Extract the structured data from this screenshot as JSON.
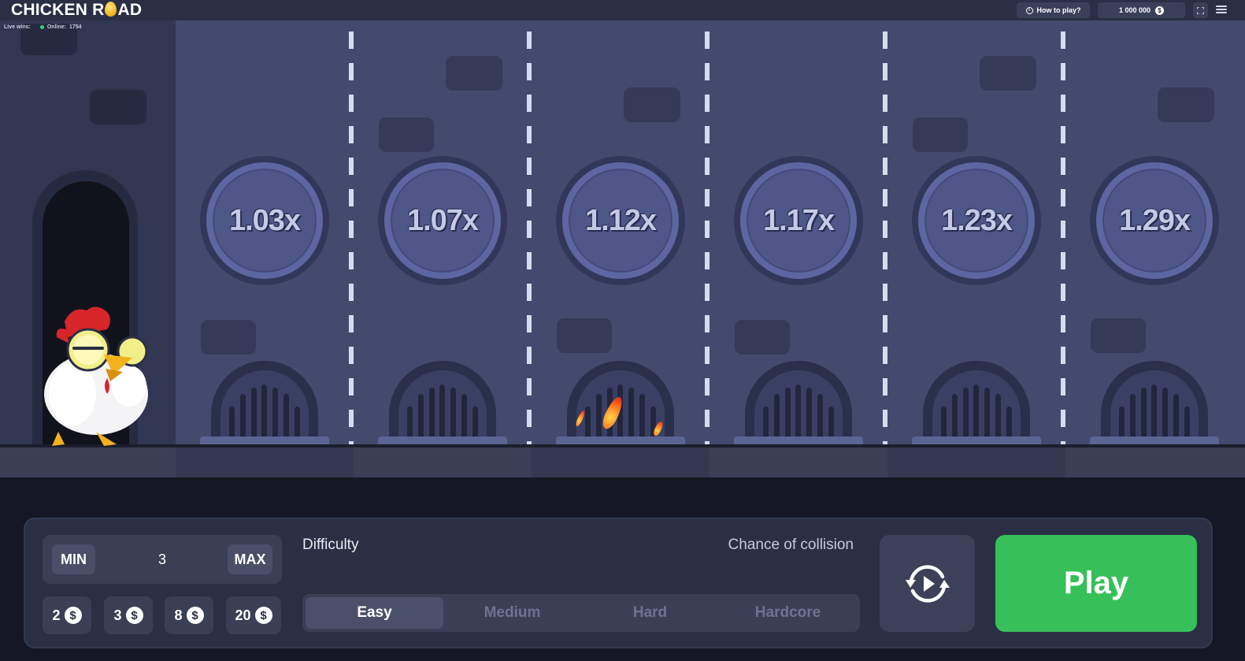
{
  "header": {
    "logo_text_left": "CHICKEN R",
    "logo_text_right": "AD",
    "how_to_play": "How to play?",
    "balance": "1 000 000",
    "currency_symbol": "$"
  },
  "livebar": {
    "live_wins_label": "Live wins:",
    "online_label": "Online:",
    "online_count": "1754"
  },
  "lanes": [
    {
      "multiplier": "1.03x",
      "fire": false
    },
    {
      "multiplier": "1.07x",
      "fire": false
    },
    {
      "multiplier": "1.12x",
      "fire": true
    },
    {
      "multiplier": "1.17x",
      "fire": false
    },
    {
      "multiplier": "1.23x",
      "fire": false
    },
    {
      "multiplier": "1.29x",
      "fire": false
    }
  ],
  "controls": {
    "min_label": "MIN",
    "max_label": "MAX",
    "bet_value": "3",
    "quick_bets": [
      {
        "amount": "2",
        "symbol": "$"
      },
      {
        "amount": "3",
        "symbol": "$"
      },
      {
        "amount": "8",
        "symbol": "$"
      },
      {
        "amount": "20",
        "symbol": "$"
      }
    ],
    "difficulty_label": "Difficulty",
    "chance_label": "Chance of collision",
    "difficulties": [
      "Easy",
      "Medium",
      "Hard",
      "Hardcore"
    ],
    "selected_difficulty": "Easy",
    "play_label": "Play"
  },
  "colors": {
    "play_button": "#37c05a",
    "field_background": "#434a6e",
    "panel_background": "#2b2f44"
  },
  "icons": {
    "info": "info-icon",
    "coin": "dollar-coin-icon",
    "fullscreen": "fullscreen-icon",
    "menu": "hamburger-menu-icon",
    "autoplay": "autoplay-refresh-icon"
  }
}
